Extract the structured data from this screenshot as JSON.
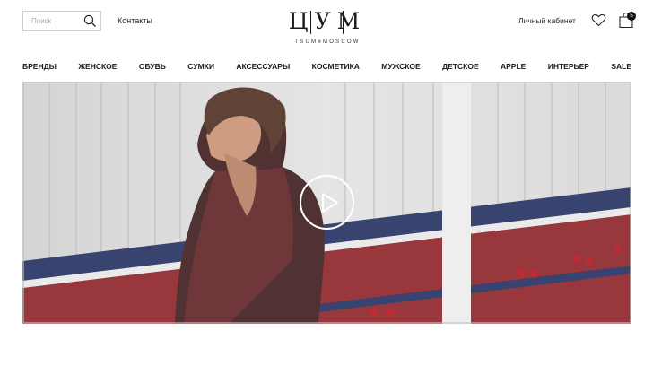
{
  "header": {
    "search": {
      "placeholder": "Поиск"
    },
    "contacts_label": "Контакты",
    "logo": {
      "mark": "ЦУМ",
      "subtitle_left": "TSUM",
      "subtitle_right": "MOSCOW"
    },
    "account_label": "Личный кабинет",
    "cart_count": "5"
  },
  "nav": {
    "items": [
      "БРЕНДЫ",
      "ЖЕНСКОЕ",
      "ОБУВЬ",
      "СУМКИ",
      "АКСЕССУАРЫ",
      "КОСМЕТИКА",
      "МУЖСКОЕ",
      "ДЕТСКОЕ",
      "APPLE",
      "ИНТЕРЬЕР",
      "SALE"
    ]
  },
  "colors": {
    "text": "#1a1a1a",
    "stripe_red": "#8a1c22",
    "stripe_navy": "#1e2a5c",
    "logo_accent": "#b88a6a"
  },
  "hero": {
    "type": "video",
    "control": "play-icon"
  }
}
